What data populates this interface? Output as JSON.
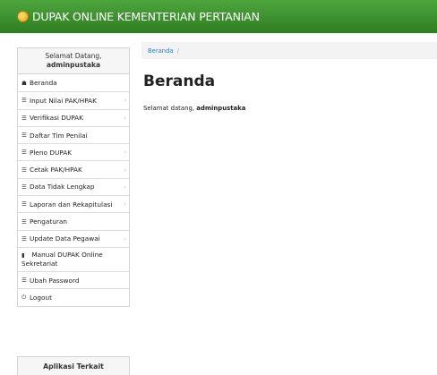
{
  "header": {
    "app_title": "DUPAK ONLINE KEMENTERIAN PERTANIAN"
  },
  "sidebar": {
    "welcome_label": "Selamat Datang,",
    "username": "adminpustaka",
    "items": [
      {
        "label": "Beranda",
        "icon": "home-icon",
        "has_submenu": false
      },
      {
        "label": "Input Nilai PAK/HPAK",
        "icon": "list-icon",
        "has_submenu": true
      },
      {
        "label": "Verifikasi DUPAK",
        "icon": "list-icon",
        "has_submenu": true
      },
      {
        "label": "Daftar Tim Penilai",
        "icon": "list-icon",
        "has_submenu": false
      },
      {
        "label": "Pleno DUPAK",
        "icon": "list-icon",
        "has_submenu": true
      },
      {
        "label": "Cetak PAK/HPAK",
        "icon": "list-icon",
        "has_submenu": true
      },
      {
        "label": "Data Tidak Lengkap",
        "icon": "list-icon",
        "has_submenu": true
      },
      {
        "label": "Laporan dan Rekapitulasi",
        "icon": "list-icon",
        "has_submenu": true
      },
      {
        "label": "Pengaturan",
        "icon": "list-icon",
        "has_submenu": false
      },
      {
        "label": "Update Data Pegawai",
        "icon": "list-icon",
        "has_submenu": true
      },
      {
        "label": "Manual DUPAK Online Sekretariat",
        "icon": "file-icon",
        "has_submenu": false
      },
      {
        "label": "Ubah Password",
        "icon": "list-icon",
        "has_submenu": false
      },
      {
        "label": "Logout",
        "icon": "power-icon",
        "has_submenu": false
      }
    ],
    "related_apps_title": "Aplikasi Terkait"
  },
  "breadcrumb": {
    "current": "Beranda",
    "separator": "/"
  },
  "main": {
    "title": "Beranda",
    "welcome_prefix": "Selamat datang,",
    "welcome_user": "adminpustaka"
  },
  "colors": {
    "header_green": "#3a8f2c",
    "link_blue": "#2a7fba"
  }
}
